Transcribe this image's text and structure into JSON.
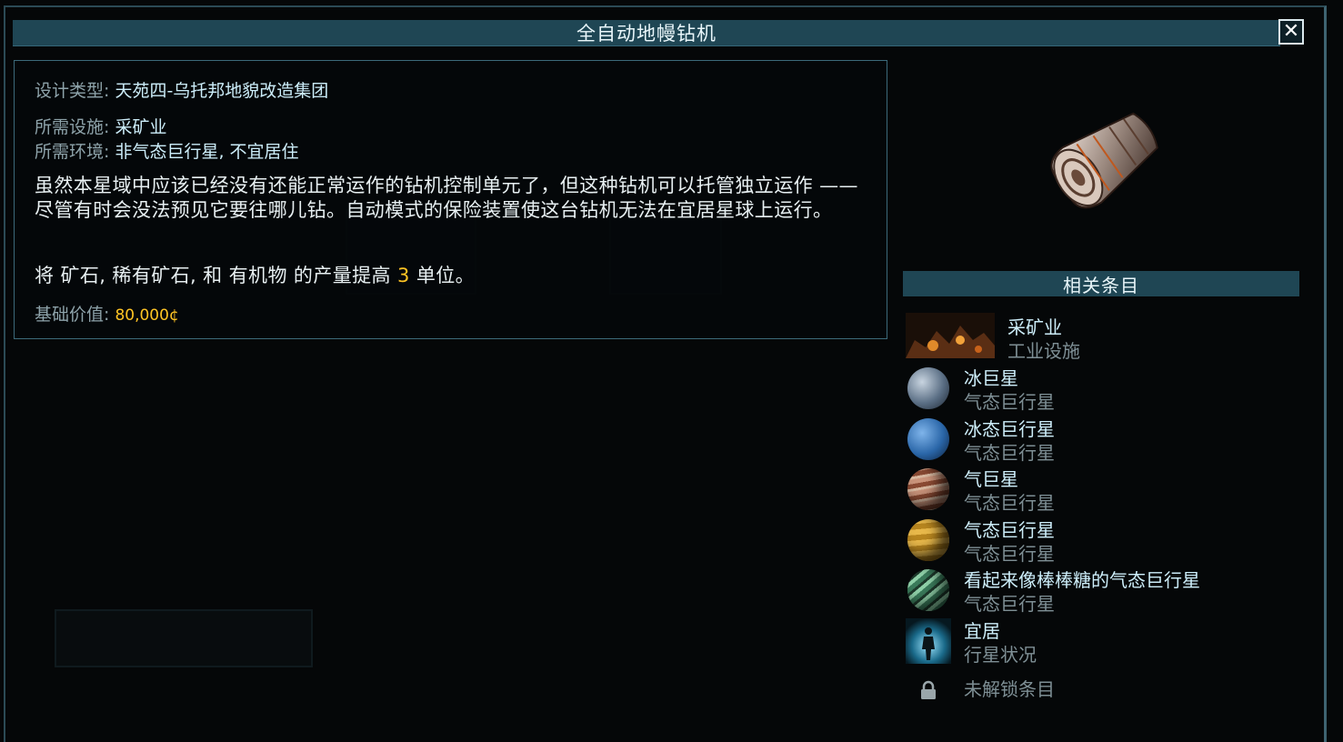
{
  "window": {
    "title": "全自动地幔钻机",
    "close_label": "✕"
  },
  "info": {
    "design_type_label": "设计类型:",
    "design_type_value": "天苑四-乌托邦地貌改造集团",
    "facility_label": "所需设施:",
    "facility_value": "采矿业",
    "environment_label": "所需环境:",
    "environment_value": "非气态巨行星, 不宜居住",
    "description": "虽然本星域中应该已经没有还能正常运作的钻机控制单元了，但这种钻机可以托管独立运作 —— 尽管有时会没法预见它要往哪儿钻。自动模式的保险装置使这台钻机无法在宜居星球上运行。",
    "effect_prefix": "将 矿石, 稀有矿石, 和 有机物 的产量提高 ",
    "effect_amount": "3",
    "effect_suffix": " 单位。",
    "base_value_label": "基础价值:",
    "base_value": "80,000¢"
  },
  "related": {
    "header": "相关条目",
    "items": [
      {
        "name": "采矿业",
        "sub": "工业设施",
        "icon": "mining-facility-icon"
      },
      {
        "name": "冰巨星",
        "sub": "气态巨行星",
        "icon": "ice-giant-planet-icon",
        "color": "#5b6f85"
      },
      {
        "name": "冰态巨行星",
        "sub": "气态巨行星",
        "icon": "ice-gas-giant-planet-icon",
        "color": "#2a66a8"
      },
      {
        "name": "气巨星",
        "sub": "气态巨行星",
        "icon": "gas-giant-planet-icon",
        "color": "#8a4a33"
      },
      {
        "name": "气态巨行星",
        "sub": "气态巨行星",
        "icon": "gas-giant-yellow-planet-icon",
        "color": "#b8861f"
      },
      {
        "name": "看起来像棒棒糖的气态巨行星",
        "sub": "气态巨行星",
        "icon": "lollipop-gas-giant-planet-icon",
        "color": "#3a7a5a"
      },
      {
        "name": "宜居",
        "sub": "行星状况",
        "icon": "habitable-figure-icon"
      }
    ],
    "locked_label": "未解锁条目"
  },
  "colors": {
    "accent_bar": "#1f4654",
    "highlight": "#ffc424",
    "value_text": "#cdeefa"
  }
}
